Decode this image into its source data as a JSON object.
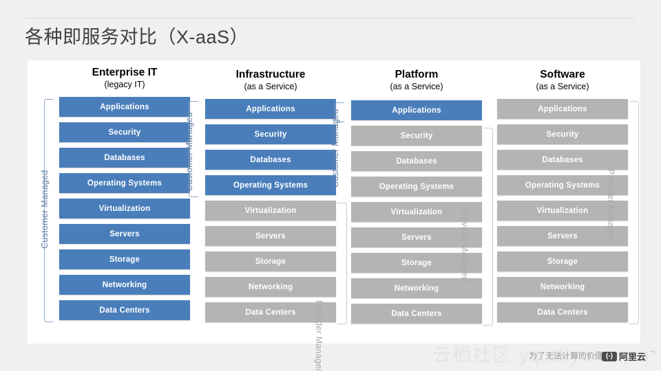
{
  "page_title": "各种即服务对比（X-aaS）",
  "colors": {
    "customer_managed": "#4a7ebb",
    "provider_managed": "#b4b4b4",
    "customer_label": "#5f7ca5",
    "provider_label": "#a8a8a8",
    "title_text": "#3f3f3f"
  },
  "bracket_labels": {
    "customer": "Customer Managed",
    "provider": "Provider Managed"
  },
  "stack_layers": [
    "Applications",
    "Security",
    "Databases",
    "Operating Systems",
    "Virtualization",
    "Servers",
    "Storage",
    "Networking",
    "Data Centers"
  ],
  "columns": [
    {
      "title": "Enterprise IT",
      "subtitle": "(legacy IT)",
      "customer_managed_count": 9,
      "provider_managed_count": 0,
      "layers": [
        {
          "label": "Applications",
          "owner": "customer"
        },
        {
          "label": "Security",
          "owner": "customer"
        },
        {
          "label": "Databases",
          "owner": "customer"
        },
        {
          "label": "Operating Systems",
          "owner": "customer"
        },
        {
          "label": "Virtualization",
          "owner": "customer"
        },
        {
          "label": "Servers",
          "owner": "customer"
        },
        {
          "label": "Storage",
          "owner": "customer"
        },
        {
          "label": "Networking",
          "owner": "customer"
        },
        {
          "label": "Data Centers",
          "owner": "customer"
        }
      ]
    },
    {
      "title": "Infrastructure",
      "subtitle": "(as a Service)",
      "customer_managed_count": 4,
      "provider_managed_count": 5,
      "layers": [
        {
          "label": "Applications",
          "owner": "customer"
        },
        {
          "label": "Security",
          "owner": "customer"
        },
        {
          "label": "Databases",
          "owner": "customer"
        },
        {
          "label": "Operating Systems",
          "owner": "customer"
        },
        {
          "label": "Virtualization",
          "owner": "provider"
        },
        {
          "label": "Servers",
          "owner": "provider"
        },
        {
          "label": "Storage",
          "owner": "provider"
        },
        {
          "label": "Networking",
          "owner": "provider"
        },
        {
          "label": "Data Centers",
          "owner": "provider"
        }
      ]
    },
    {
      "title": "Platform",
      "subtitle": "(as a Service)",
      "customer_managed_count": 1,
      "provider_managed_count": 8,
      "layers": [
        {
          "label": "Applications",
          "owner": "customer"
        },
        {
          "label": "Security",
          "owner": "provider"
        },
        {
          "label": "Databases",
          "owner": "provider"
        },
        {
          "label": "Operating Systems",
          "owner": "provider"
        },
        {
          "label": "Virtualization",
          "owner": "provider"
        },
        {
          "label": "Servers",
          "owner": "provider"
        },
        {
          "label": "Storage",
          "owner": "provider"
        },
        {
          "label": "Networking",
          "owner": "provider"
        },
        {
          "label": "Data Centers",
          "owner": "provider"
        }
      ]
    },
    {
      "title": "Software",
      "subtitle": "(as a Service)",
      "customer_managed_count": 0,
      "provider_managed_count": 9,
      "layers": [
        {
          "label": "Applications",
          "owner": "provider"
        },
        {
          "label": "Security",
          "owner": "provider"
        },
        {
          "label": "Databases",
          "owner": "provider"
        },
        {
          "label": "Operating Systems",
          "owner": "provider"
        },
        {
          "label": "Virtualization",
          "owner": "provider"
        },
        {
          "label": "Servers",
          "owner": "provider"
        },
        {
          "label": "Storage",
          "owner": "provider"
        },
        {
          "label": "Networking",
          "owner": "provider"
        },
        {
          "label": "Data Centers",
          "owner": "provider"
        }
      ]
    }
  ],
  "watermark": {
    "site": "云栖社区 yq.aliyun.com",
    "slogan": "为了无法计算的价值",
    "separator": "|",
    "brand": "阿里云",
    "logo_glyph": "(-)"
  }
}
